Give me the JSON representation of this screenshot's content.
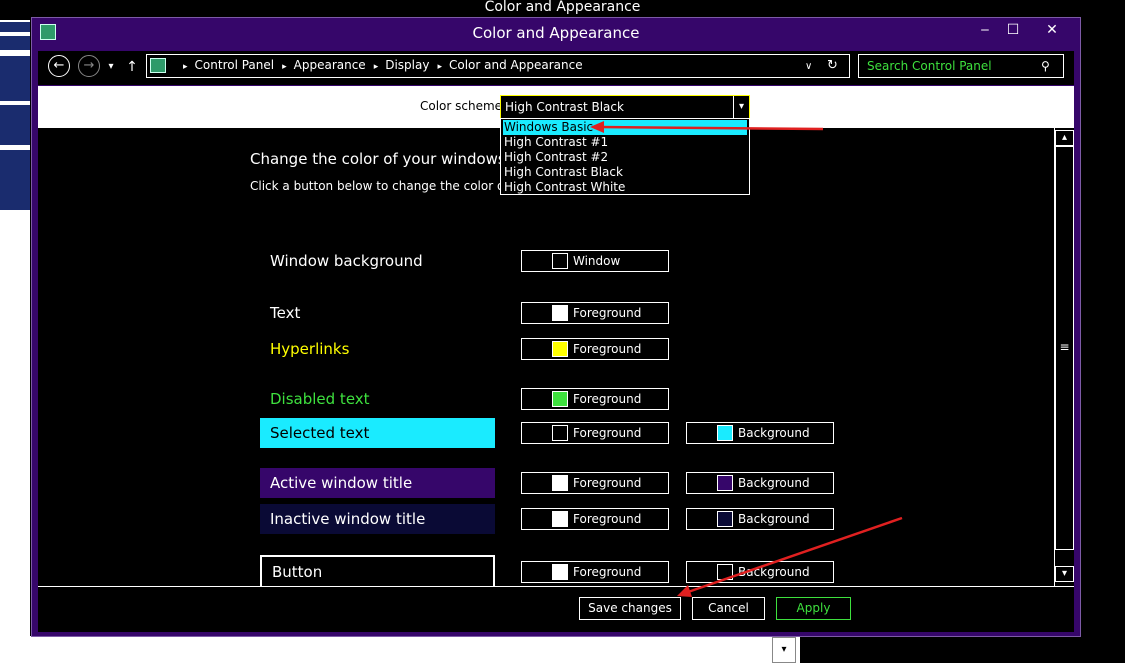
{
  "background_window": {
    "title": "Color and Appearance"
  },
  "window": {
    "title": "Color and Appearance",
    "icons": {
      "app": "monitor-icon",
      "minimize": "minimize-icon",
      "maximize": "maximize-icon",
      "close": "close-icon"
    },
    "controls": {
      "minimize": "‒",
      "maximize": "☐",
      "close": "✕"
    }
  },
  "navigation": {
    "back": "←",
    "forward": "→",
    "history": "▾",
    "up": "↑",
    "breadcrumbs": [
      "Control Panel",
      "Appearance",
      "Display",
      "Color and Appearance"
    ],
    "separator": "▸",
    "dropdown": "∨",
    "refresh": "↻",
    "search_placeholder": "Search Control Panel",
    "search_glyph": "⚲"
  },
  "scheme": {
    "label": "Color scheme:",
    "selected": "High Contrast Black",
    "arrow": "▾",
    "options": [
      "Windows Basic",
      "High Contrast #1",
      "High Contrast #2",
      "High Contrast Black",
      "High Contrast White"
    ],
    "highlighted_index": 0
  },
  "content": {
    "heading": "Change the color of your windows a",
    "subheading": "Click a button below to change the color of you"
  },
  "rows": [
    {
      "label": "Window background",
      "label_color": "#ffffff",
      "label_bg": "transparent",
      "fg_text": "Window",
      "fg_swatch": "#000000",
      "bg_text": null,
      "bg_swatch": null
    },
    {
      "label": "Text",
      "label_color": "#ffffff",
      "label_bg": "transparent",
      "fg_text": "Foreground",
      "fg_swatch": "#ffffff",
      "bg_text": null,
      "bg_swatch": null
    },
    {
      "label": "Hyperlinks",
      "label_color": "#ffff00",
      "label_bg": "transparent",
      "fg_text": "Foreground",
      "fg_swatch": "#ffff00",
      "bg_text": null,
      "bg_swatch": null
    },
    {
      "label": "Disabled text",
      "label_color": "#3ee03e",
      "label_bg": "transparent",
      "fg_text": "Foreground",
      "fg_swatch": "#3ee03e",
      "bg_text": null,
      "bg_swatch": null
    },
    {
      "label": "Selected text",
      "label_color": "#000000",
      "label_bg": "#1aebff",
      "fg_text": "Foreground",
      "fg_swatch": "#000000",
      "bg_text": "Background",
      "bg_swatch": "#1aebff"
    },
    {
      "label": "Active window title",
      "label_color": "#ffffff",
      "label_bg": "#36066a",
      "fg_text": "Foreground",
      "fg_swatch": "#ffffff",
      "bg_text": "Background",
      "bg_swatch": "#36066a"
    },
    {
      "label": "Inactive window title",
      "label_color": "#ffffff",
      "label_bg": "#0a0a35",
      "fg_text": "Foreground",
      "fg_swatch": "#ffffff",
      "bg_text": "Background",
      "bg_swatch": "#0a0a35"
    },
    {
      "label": "Button",
      "label_color": "#ffffff",
      "label_bg": "#000000",
      "fg_text": "Foreground",
      "fg_swatch": "#ffffff",
      "bg_text": "Background",
      "bg_swatch": "#000000"
    }
  ],
  "scrollbar": {
    "up": "▴",
    "down": "▾",
    "thumb": "≡"
  },
  "buttons": {
    "save": "Save changes",
    "cancel": "Cancel",
    "apply": "Apply"
  },
  "colors": {
    "accent": "#36066a",
    "highlight": "#1aebff",
    "disabled": "#3ee03e",
    "hyperlink": "#ffff00",
    "annotation": "#e02020"
  },
  "annotation": {
    "arrow_targets": [
      "Windows Basic",
      "Save changes"
    ]
  }
}
